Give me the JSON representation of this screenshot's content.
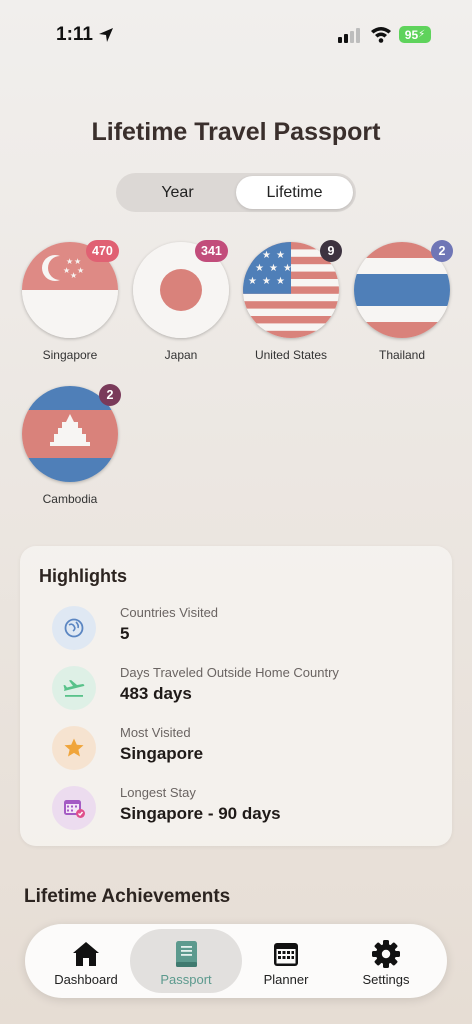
{
  "status": {
    "time": "1:11",
    "battery": "95"
  },
  "title": "Lifetime Travel Passport",
  "segments": {
    "year": "Year",
    "lifetime": "Lifetime",
    "selected": "Lifetime"
  },
  "countries": [
    {
      "name": "Singapore",
      "count": "470",
      "badge_color": "#e06173"
    },
    {
      "name": "Japan",
      "count": "341",
      "badge_color": "#c24d7b"
    },
    {
      "name": "United States",
      "count": "9",
      "badge_color": "#3d3340"
    },
    {
      "name": "Thailand",
      "count": "2",
      "badge_color": "#6f76b6"
    },
    {
      "name": "Cambodia",
      "count": "2",
      "badge_color": "#7a3a5a"
    }
  ],
  "highlights": {
    "title": "Highlights",
    "rows": [
      {
        "label": "Countries Visited",
        "value": "5",
        "icon": "globe-icon"
      },
      {
        "label": "Days Traveled Outside Home Country",
        "value": "483 days",
        "icon": "airplane-icon"
      },
      {
        "label": "Most Visited",
        "value": "Singapore",
        "icon": "star-icon"
      },
      {
        "label": "Longest Stay",
        "value": "Singapore - 90 days",
        "icon": "calendar-icon"
      }
    ]
  },
  "achievements_title": "Lifetime Achievements",
  "tabs": [
    {
      "label": "Dashboard",
      "icon": "house-icon"
    },
    {
      "label": "Passport",
      "icon": "passport-book-icon"
    },
    {
      "label": "Planner",
      "icon": "calendar-icon"
    },
    {
      "label": "Settings",
      "icon": "gear-icon"
    }
  ],
  "active_tab": "Passport"
}
